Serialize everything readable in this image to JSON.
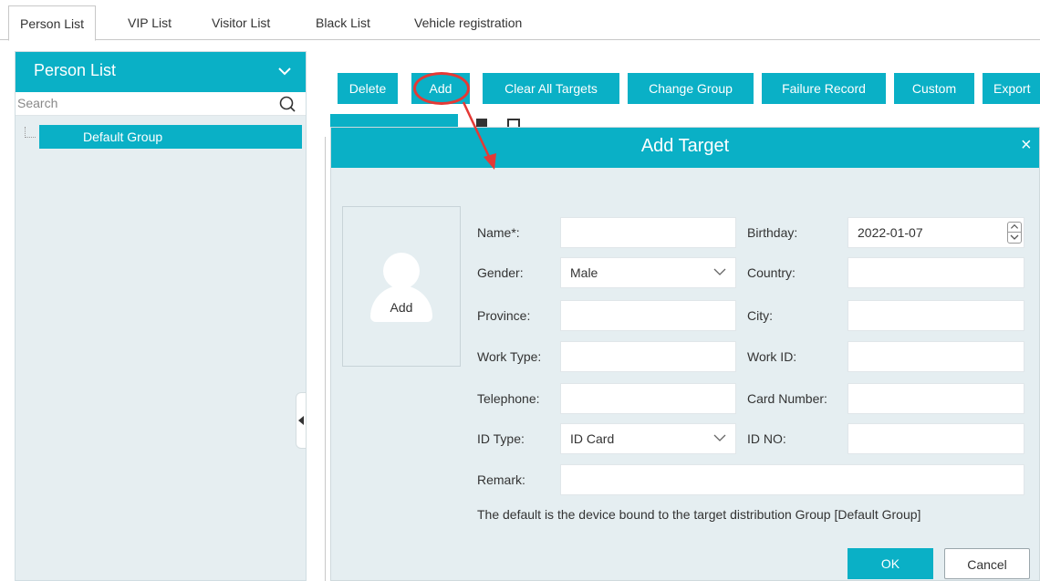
{
  "tabs": [
    {
      "label": "Person List",
      "active": true
    },
    {
      "label": "VIP List"
    },
    {
      "label": "Visitor List"
    },
    {
      "label": "Black List"
    },
    {
      "label": "Vehicle registration"
    }
  ],
  "sidebar": {
    "title": "Person List",
    "search_placeholder": "Search",
    "groups": [
      {
        "label": "Default Group",
        "selected": true
      }
    ]
  },
  "toolbar": {
    "buttons": [
      "Delete",
      "Add",
      "Clear All Targets",
      "Change Group",
      "Failure Record",
      "Custom",
      "Export"
    ]
  },
  "dialog": {
    "title": "Add Target",
    "close": "×",
    "photo_label": "Add",
    "fields": {
      "name": {
        "label": "Name*:",
        "value": ""
      },
      "birthday": {
        "label": "Birthday:",
        "value": "2022-01-07"
      },
      "gender": {
        "label": "Gender:",
        "value": "Male"
      },
      "country": {
        "label": "Country:",
        "value": ""
      },
      "province": {
        "label": "Province:",
        "value": ""
      },
      "city": {
        "label": "City:",
        "value": ""
      },
      "work_type": {
        "label": "Work Type:",
        "value": ""
      },
      "work_id": {
        "label": "Work ID:",
        "value": ""
      },
      "telephone": {
        "label": "Telephone:",
        "value": ""
      },
      "card_number": {
        "label": "Card Number:",
        "value": ""
      },
      "id_type": {
        "label": "ID Type:",
        "value": "ID Card"
      },
      "id_no": {
        "label": "ID NO:",
        "value": ""
      },
      "remark": {
        "label": "Remark:",
        "value": ""
      }
    },
    "note": "The default is the device bound to the target distribution Group [Default Group]",
    "ok": "OK",
    "cancel": "Cancel"
  },
  "colors": {
    "accent": "#0ab0c6",
    "panel_bg": "#e5eef1",
    "annotation": "#e53935"
  },
  "icons": [
    "chevron-down-icon",
    "search-icon",
    "close-icon",
    "person-avatar-icon",
    "spinner-icon",
    "collapse-arrow-icon"
  ]
}
